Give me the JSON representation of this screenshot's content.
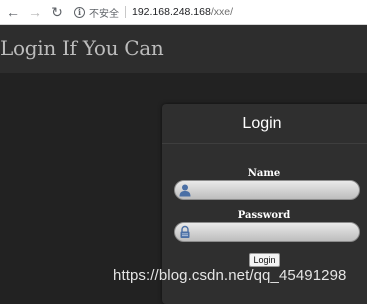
{
  "browser": {
    "back_icon": "arrow-left-icon",
    "forward_icon": "arrow-right-icon",
    "reload_icon": "reload-icon",
    "info_icon": "info-icon",
    "security_label": "不安全",
    "url_host": "192.168.248.168",
    "url_path": "/xxe/"
  },
  "header": {
    "title": "Login If You Can"
  },
  "login": {
    "heading": "Login",
    "name_label": "Name",
    "name_icon": "user-icon",
    "name_value": "",
    "password_label": "Password",
    "password_icon": "lock-icon",
    "password_value": "",
    "submit_label": "Login"
  },
  "watermark": "https://blog.csdn.net/qq_45491298",
  "colors": {
    "page_background": "#222222",
    "header_background": "#2d2d2d",
    "panel_background": "#2f2f2f",
    "icon_blue": "#4a6fa5"
  }
}
